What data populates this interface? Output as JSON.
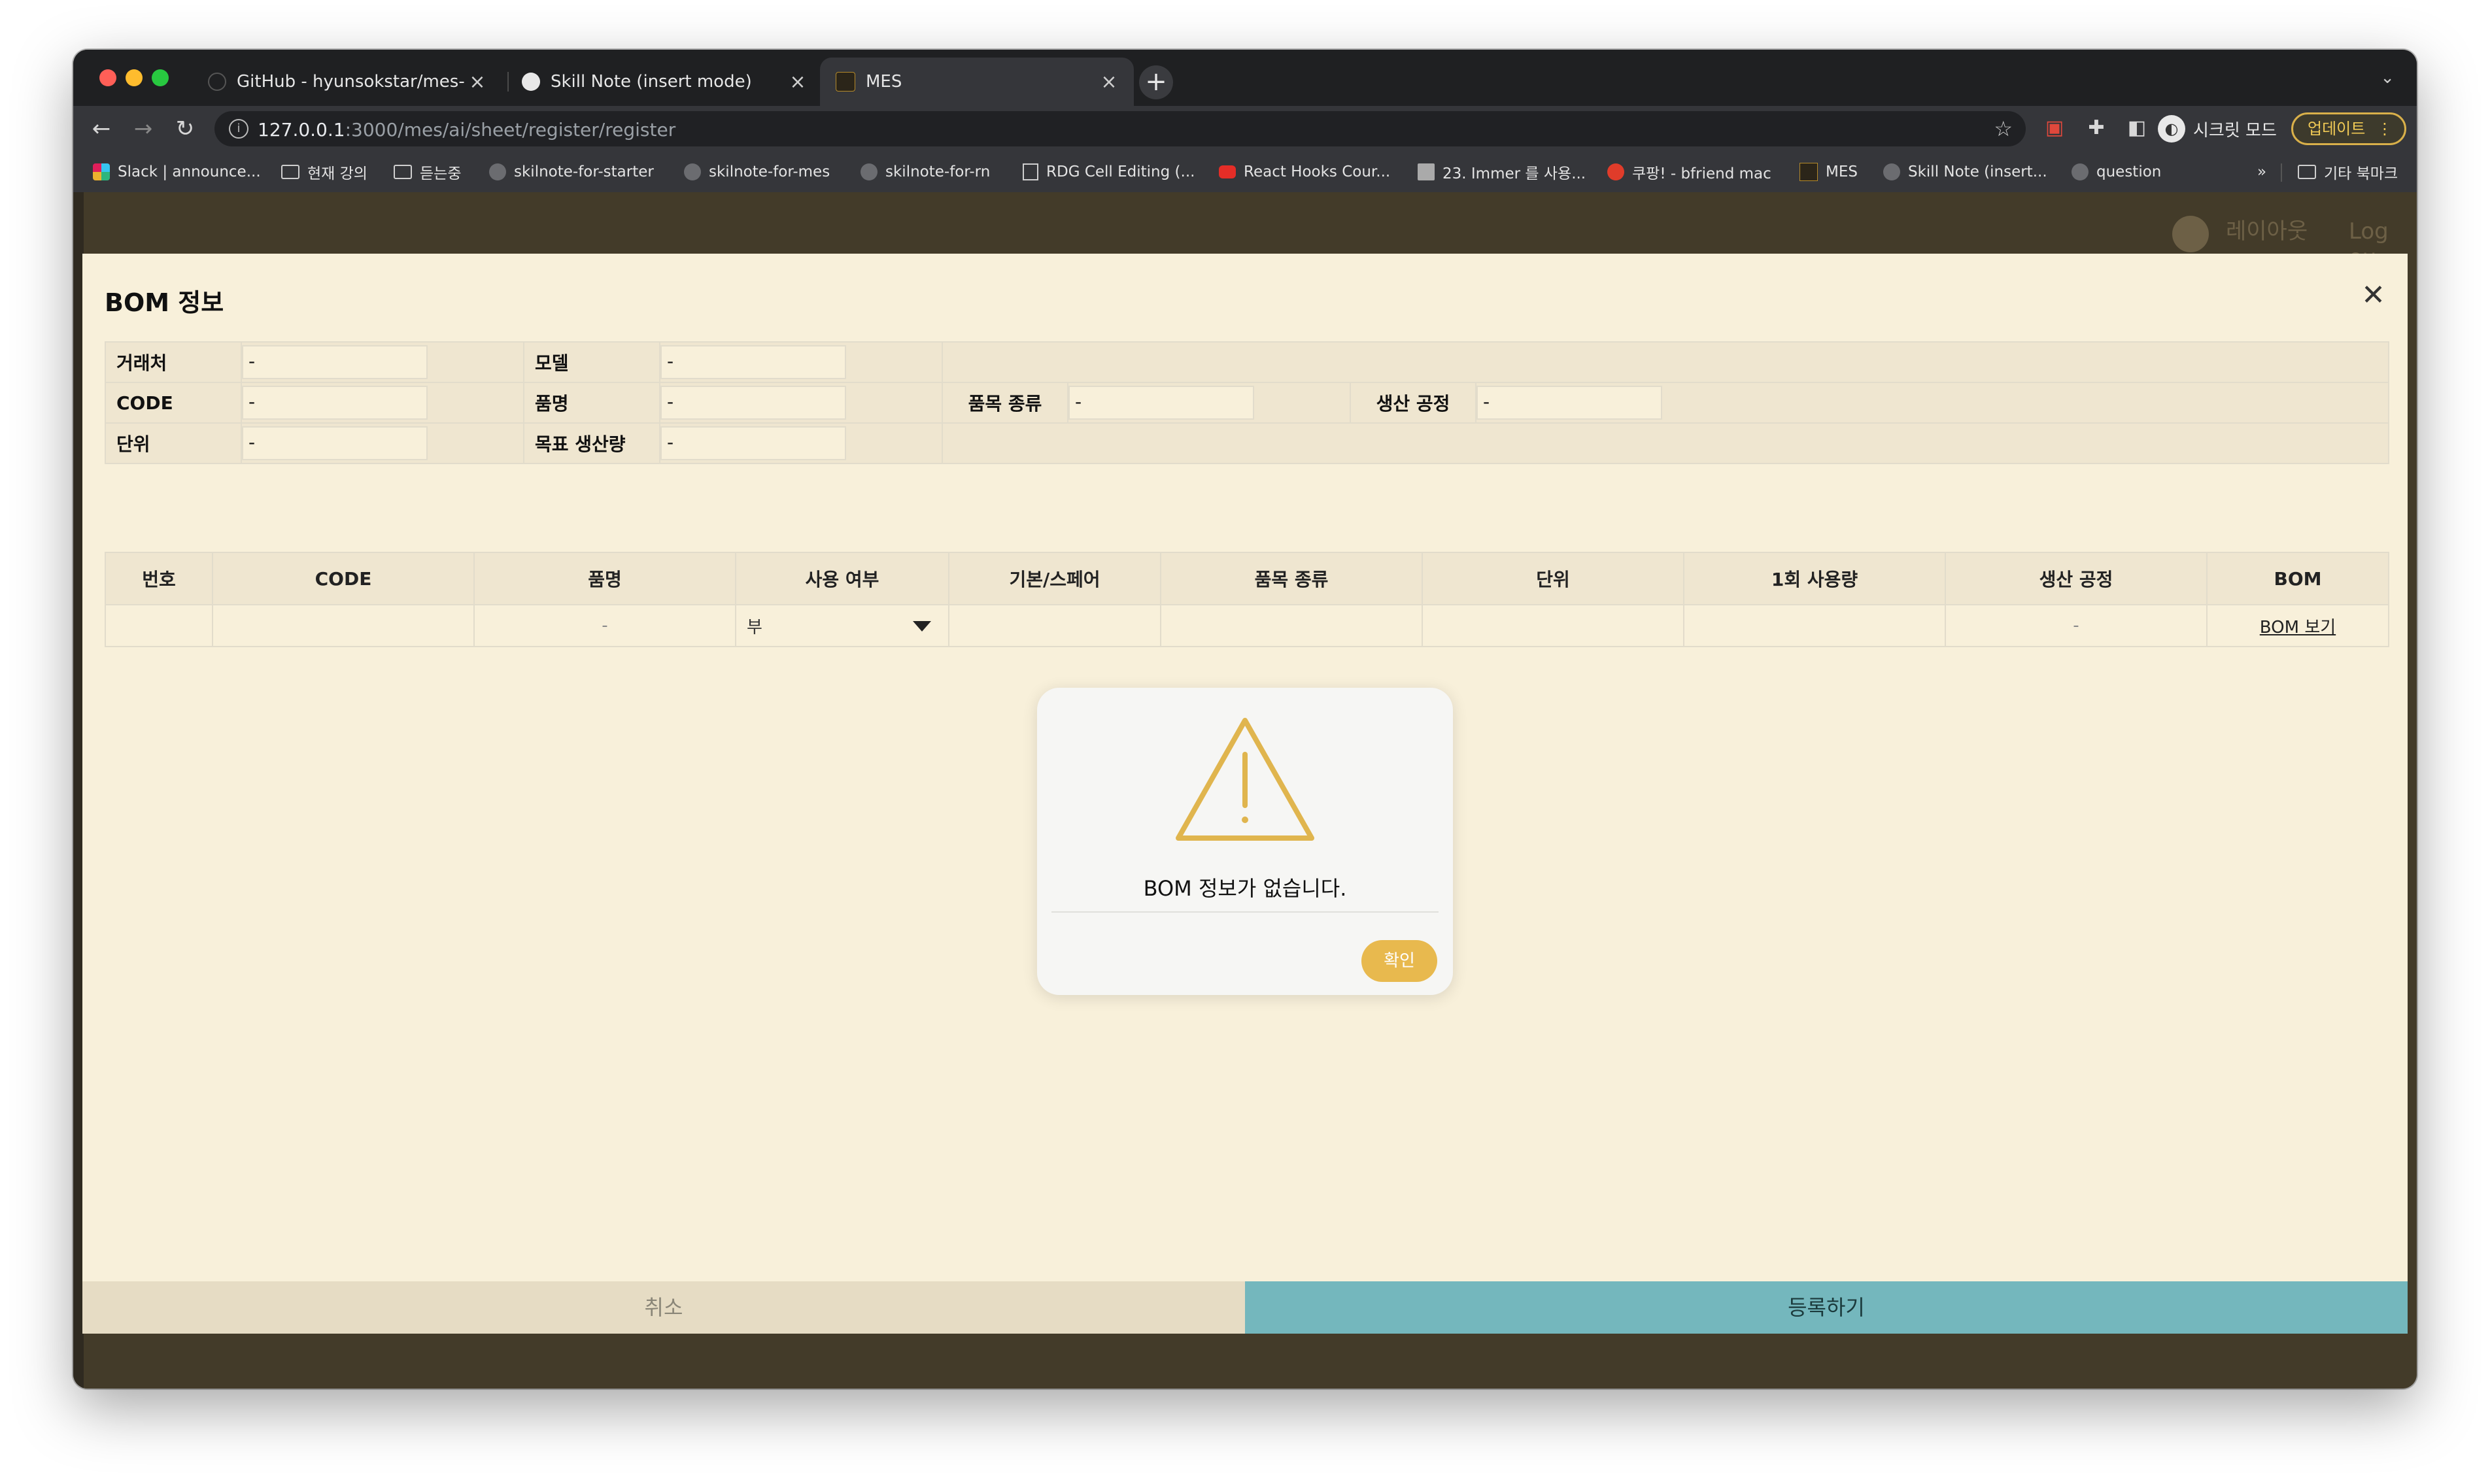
{
  "browser": {
    "tabs": [
      {
        "title": "GitHub - hyunsokstar/mes-pro",
        "favicon": "github-icon"
      },
      {
        "title": "Skill Note (insert mode)",
        "favicon": "globe-icon"
      },
      {
        "title": "MES",
        "favicon": "mes-icon"
      }
    ],
    "new_tab_label": "+",
    "url_host": "127.0.0.1",
    "url_rest": ":3000/mes/ai/sheet/register/register",
    "incognito_label": "시크릿 모드",
    "update_label": "업데이트"
  },
  "bookmarks": [
    {
      "label": "Slack | announce...",
      "icon": "slack"
    },
    {
      "label": "현재 강의",
      "icon": "folder"
    },
    {
      "label": "듣는중",
      "icon": "folder"
    },
    {
      "label": "skilnote-for-starter",
      "icon": "globe"
    },
    {
      "label": "skilnote-for-mes",
      "icon": "globe"
    },
    {
      "label": "skilnote-for-rn",
      "icon": "globe"
    },
    {
      "label": "RDG Cell Editing (...",
      "icon": "doc"
    },
    {
      "label": "React Hooks Cour...",
      "icon": "yt"
    },
    {
      "label": "23. Immer 를 사용...",
      "icon": "book"
    },
    {
      "label": "쿠팡! - bfriend mac",
      "icon": "coupang"
    },
    {
      "label": "MES",
      "icon": "mes"
    },
    {
      "label": "Skill Note (insert...",
      "icon": "globe"
    },
    {
      "label": "question",
      "icon": "globe"
    }
  ],
  "bookmarks_more": "»",
  "bookmarks_other": "기타 북마크",
  "background_header": {
    "layout_label": "레이아웃",
    "logout_label": "Log ou"
  },
  "modal": {
    "title": "BOM 정보",
    "info": {
      "customer_label": "거래처",
      "customer_value": "-",
      "model_label": "모델",
      "model_value": "-",
      "code_label": "CODE",
      "code_value": "-",
      "name_label": "품명",
      "name_value": "-",
      "type_label": "품목 종류",
      "type_value": "-",
      "process_label": "생산 공정",
      "process_value": "-",
      "unit_label": "단위",
      "unit_value": "-",
      "target_label": "목표 생산량",
      "target_value": "-"
    },
    "table": {
      "headers": [
        "번호",
        "CODE",
        "품명",
        "사용 여부",
        "기본/스페어",
        "품목 종류",
        "단위",
        "1회 사용량",
        "생산 공정",
        "BOM"
      ],
      "row": {
        "no": "",
        "code": "",
        "name": "-",
        "use": "부",
        "spare": "",
        "type": "",
        "unit": "",
        "usage": "",
        "process": "-",
        "bom": "BOM 보기"
      }
    },
    "cancel_label": "취소",
    "submit_label": "등록하기"
  },
  "alert": {
    "message": "BOM 정보가 없습니다.",
    "confirm_label": "확인",
    "icon": "warning-icon",
    "accent_color": "#e8b94e"
  }
}
